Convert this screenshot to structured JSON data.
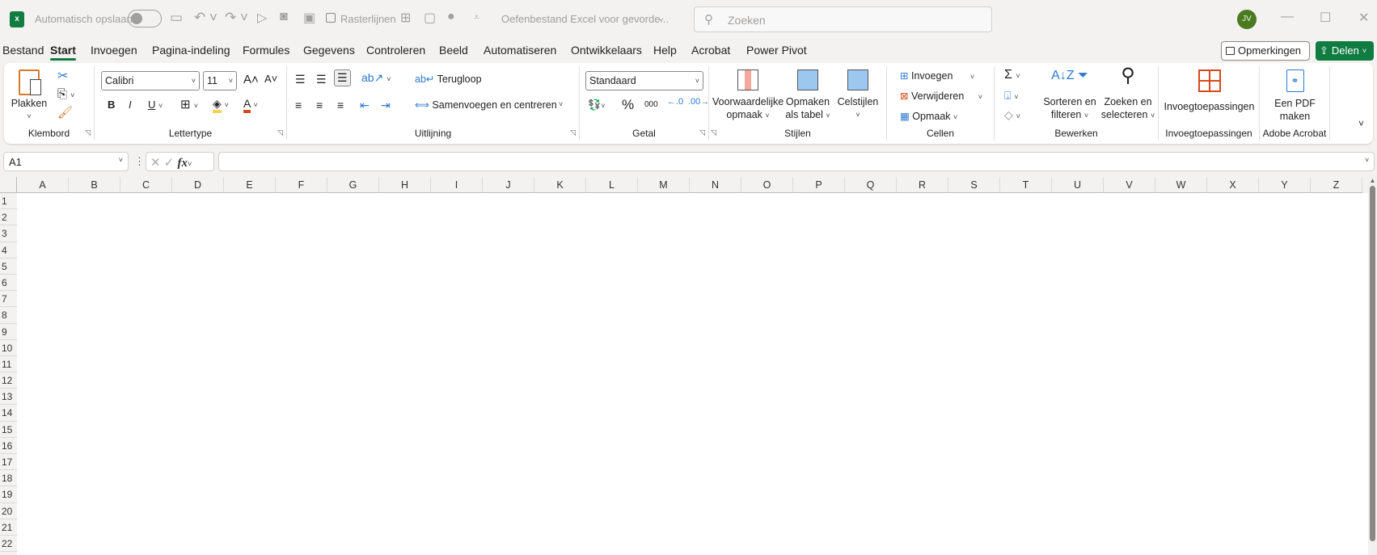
{
  "titlebar": {
    "autosave_label": "Automatisch opslaan",
    "gridlines_label": "Rasterlijnen",
    "gridlines_checked": false,
    "doc_title": "Oefenbestand Excel voor gevorde...",
    "search_placeholder": "Zoeken",
    "avatar": "JV",
    "avatar_color": "#4b7a1f"
  },
  "tabs": [
    "Bestand",
    "Start",
    "Invoegen",
    "Pagina-indeling",
    "Formules",
    "Gegevens",
    "Controleren",
    "Beeld",
    "Automatiseren",
    "Ontwikkelaars",
    "Help",
    "Acrobat",
    "Power Pivot"
  ],
  "active_tab": "Start",
  "comments_label": "Opmerkingen",
  "share_label": "Delen",
  "accent": "#107c41",
  "ribbon": {
    "clipboard": {
      "label": "Klembord",
      "paste": "Plakken"
    },
    "font": {
      "label": "Lettertype",
      "family": "Calibri",
      "size": "11",
      "bold": "B",
      "italic": "I",
      "underline": "U",
      "color_letter": "A"
    },
    "alignment": {
      "label": "Uitlijning",
      "wrap": "Terugloop",
      "merge": "Samenvoegen en centreren"
    },
    "number": {
      "label": "Getal",
      "format": "Standaard",
      "percent": "%",
      "thousands": "000"
    },
    "styles": {
      "label": "Stijlen",
      "conditional": [
        "Voorwaardelijke",
        "opmaak"
      ],
      "as_table": [
        "Opmaken",
        "als tabel"
      ],
      "cell_styles": "Celstijlen"
    },
    "cells": {
      "label": "Cellen",
      "insert": "Invoegen",
      "delete": "Verwijderen",
      "format": "Opmaak"
    },
    "editing": {
      "label": "Bewerken",
      "sort": [
        "Sorteren en",
        "filteren"
      ],
      "find": [
        "Zoeken en",
        "selecteren"
      ]
    },
    "addins": {
      "label": "Invoegtoepassingen",
      "button": "Invoegtoepassingen"
    },
    "acrobat": {
      "label": "Adobe Acrobat",
      "button": [
        "Een PDF",
        "maken"
      ]
    }
  },
  "formula_bar": {
    "name_box": "A1",
    "fx": "fx",
    "value": ""
  },
  "columns": [
    "A",
    "B",
    "C",
    "D",
    "E",
    "F",
    "G",
    "H",
    "I",
    "J",
    "K",
    "L",
    "M",
    "N",
    "O",
    "P",
    "Q",
    "R",
    "S",
    "T",
    "U",
    "V",
    "W",
    "X",
    "Y",
    "Z"
  ],
  "rows": [
    "1",
    "2",
    "3",
    "4",
    "5",
    "6",
    "7",
    "8",
    "9",
    "10",
    "11",
    "12",
    "13",
    "14",
    "15",
    "16",
    "17",
    "18",
    "19",
    "20",
    "21",
    "22"
  ]
}
